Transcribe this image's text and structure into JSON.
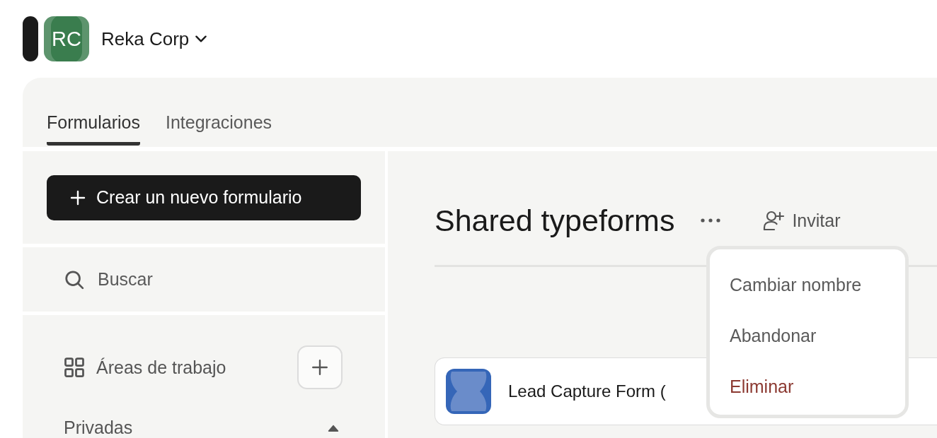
{
  "workspace": {
    "initials": "RC",
    "name": "Reka Corp"
  },
  "tabs": [
    {
      "label": "Formularios",
      "selected": true
    },
    {
      "label": "Integraciones",
      "selected": false
    }
  ],
  "sidebar": {
    "create_button": "Crear un nuevo formulario",
    "search": {
      "placeholder": "Buscar"
    },
    "workspaces_label": "Áreas de trabajo",
    "sections": [
      {
        "label": "Privadas",
        "expanded": true
      }
    ]
  },
  "main": {
    "title": "Shared typeforms",
    "invite_button": "Invitar",
    "forms": [
      {
        "title": "Lead Capture Form ("
      }
    ]
  },
  "menu": {
    "items": [
      {
        "label": "Cambiar nombre",
        "kind": "normal"
      },
      {
        "label": "Abandonar",
        "kind": "normal"
      },
      {
        "label": "Eliminar",
        "kind": "danger"
      }
    ]
  }
}
